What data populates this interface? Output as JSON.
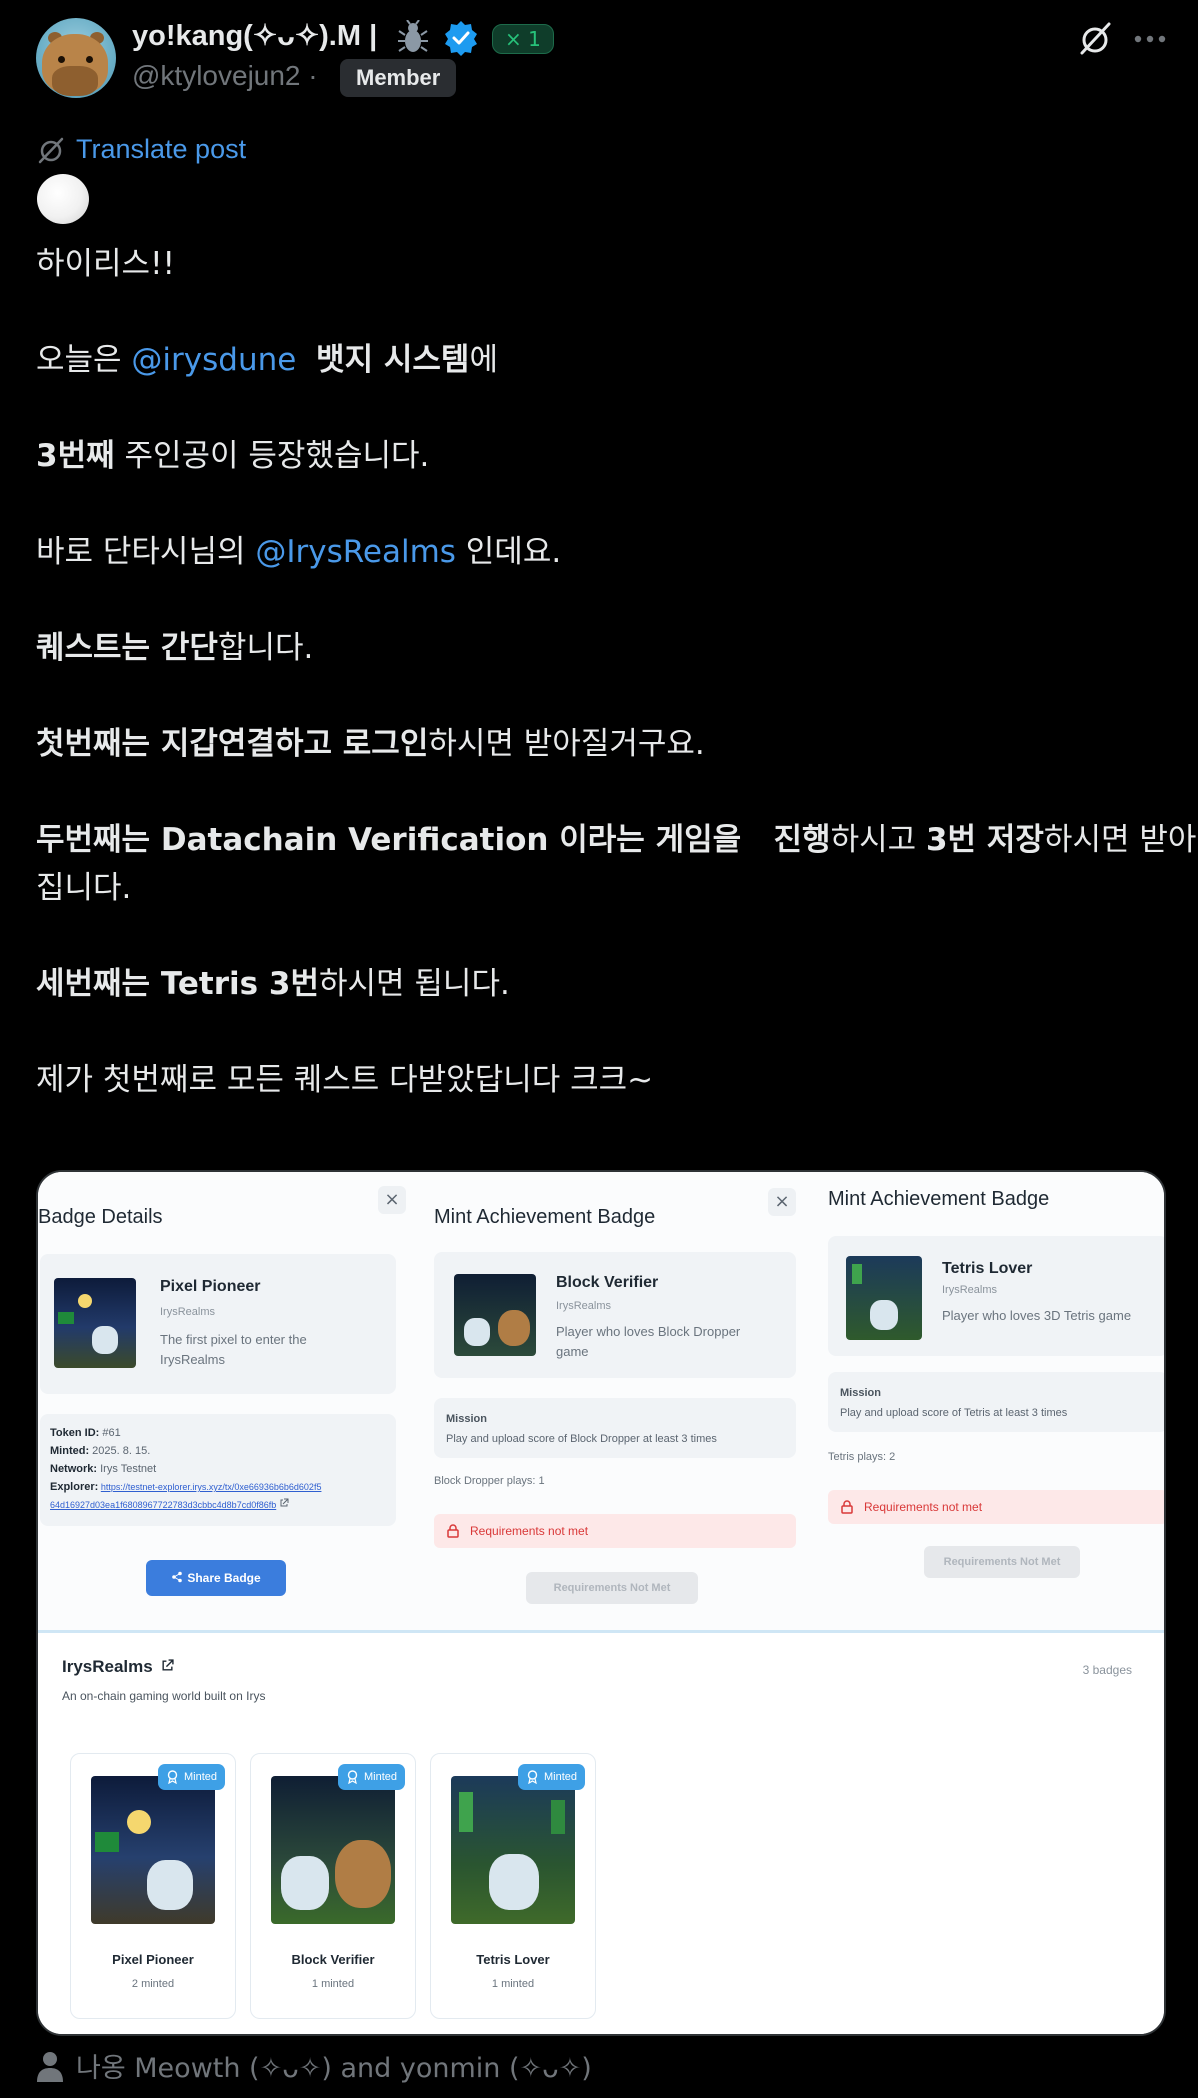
{
  "post": {
    "author": {
      "display_name": "yo!kang(✧ᴗ✧).M |",
      "affiliate_badge": "× 1",
      "handle": "@ktylovejun2",
      "handle_sep": "·",
      "role_badge": "Member"
    },
    "translate_label": "Translate post",
    "body": [
      {
        "segments": [
          {
            "text": "하이리스!!"
          }
        ]
      },
      {
        "segments": [
          {
            "text": "오늘은 "
          },
          {
            "text": "@irysdune",
            "style": "mention"
          },
          {
            "text": "  "
          },
          {
            "text": "뱃지 시스템",
            "style": "bold"
          },
          {
            "text": "에"
          }
        ]
      },
      {
        "segments": [
          {
            "text": "3번째",
            "style": "bold"
          },
          {
            "text": " 주인공이 등장했습니다."
          }
        ]
      },
      {
        "segments": [
          {
            "text": "바로 단타시님의 "
          },
          {
            "text": "@IrysRealms",
            "style": "mention"
          },
          {
            "text": " 인데요."
          }
        ]
      },
      {
        "segments": [
          {
            "text": "퀘스트는 간단",
            "style": "bold"
          },
          {
            "text": "합니다."
          }
        ]
      },
      {
        "segments": [
          {
            "text": "첫번째는 지갑연결하고 로그인",
            "style": "bold"
          },
          {
            "text": "하시면 받아질거구요."
          }
        ]
      },
      {
        "segments": [
          {
            "text": "두번째는 Datachain Verification 이라는 게임을   진행",
            "style": "bold"
          },
          {
            "text": "하시고 "
          },
          {
            "text": "3번 저장",
            "style": "bold"
          },
          {
            "text": "하시면 받아"
          }
        ]
      },
      {
        "segments": [
          {
            "text": "집니다."
          }
        ]
      },
      {
        "segments": [
          {
            "text": "세번째는 Tetris 3번",
            "style": "bold"
          },
          {
            "text": "하시면 됩니다."
          }
        ]
      },
      {
        "segments": [
          {
            "text": "제가 첫번째로 모든 퀘스트 다받았답니다 크크~"
          }
        ]
      }
    ],
    "footer_text": "나옹 Meowth (✧ᴗ✧) and yonmin (✧ᴗ✧)"
  },
  "image": {
    "badge_details": {
      "title": "Badge Details",
      "close": "×",
      "item_name": "Pixel Pioneer",
      "item_org": "IrysRealms",
      "item_desc": "The first pixel to enter the IrysRealms",
      "token_label": "Token ID:",
      "token_value": "#61",
      "minted_label": "Minted:",
      "minted_value": "2025. 8. 15.",
      "network_label": "Network:",
      "network_value": "Irys Testnet",
      "explorer_label": "Explorer:",
      "explorer_line1": "https://testnet-explorer.irys.xyz/tx/0xe66936b6b6d602f5",
      "explorer_line2": "64d16927d03ea1f6808967722783d3cbbc4d8b7cd0f86fb",
      "share_label": "Share Badge"
    },
    "mint_block": {
      "title": "Mint Achievement Badge",
      "close": "×",
      "item_name": "Block Verifier",
      "item_org": "IrysRealms",
      "item_desc": "Player who loves Block Dropper game",
      "mission_label": "Mission",
      "mission_text": "Play and upload score of Block Dropper at least 3 times",
      "plays": "Block Dropper plays: 1",
      "req_text": "Requirements not met",
      "btn_text": "Requirements Not Met"
    },
    "mint_tetris": {
      "title": "Mint Achievement Badge",
      "item_name": "Tetris Lover",
      "item_org": "IrysRealms",
      "item_desc": "Player who loves 3D Tetris game",
      "mission_label": "Mission",
      "mission_text": "Play and upload score of Tetris at least 3 times",
      "plays": "Tetris plays: 2",
      "req_text": "Requirements not met",
      "btn_text": "Requirements Not Met"
    },
    "gallery": {
      "title": "IrysRealms",
      "subtitle": "An on-chain gaming world built on Irys",
      "count": "3 badges",
      "minted_label": "Minted",
      "badges": [
        {
          "name": "Pixel Pioneer",
          "count": "2 minted"
        },
        {
          "name": "Block Verifier",
          "count": "1 minted"
        },
        {
          "name": "Tetris Lover",
          "count": "1 minted"
        }
      ]
    }
  },
  "colors": {
    "background": "#000000",
    "text": "#e7e9ea",
    "muted": "#71767b",
    "mention": "#4a99e9",
    "verified": "#1d9bf0",
    "affiliate_green": "#27c27a"
  },
  "icons": [
    "avatar-capybara",
    "bug-icon",
    "verified-icon",
    "grok-icon",
    "more-icon",
    "translate-icon",
    "person-icon",
    "lock-icon",
    "share-icon",
    "external-link-icon",
    "minted-icon"
  ]
}
